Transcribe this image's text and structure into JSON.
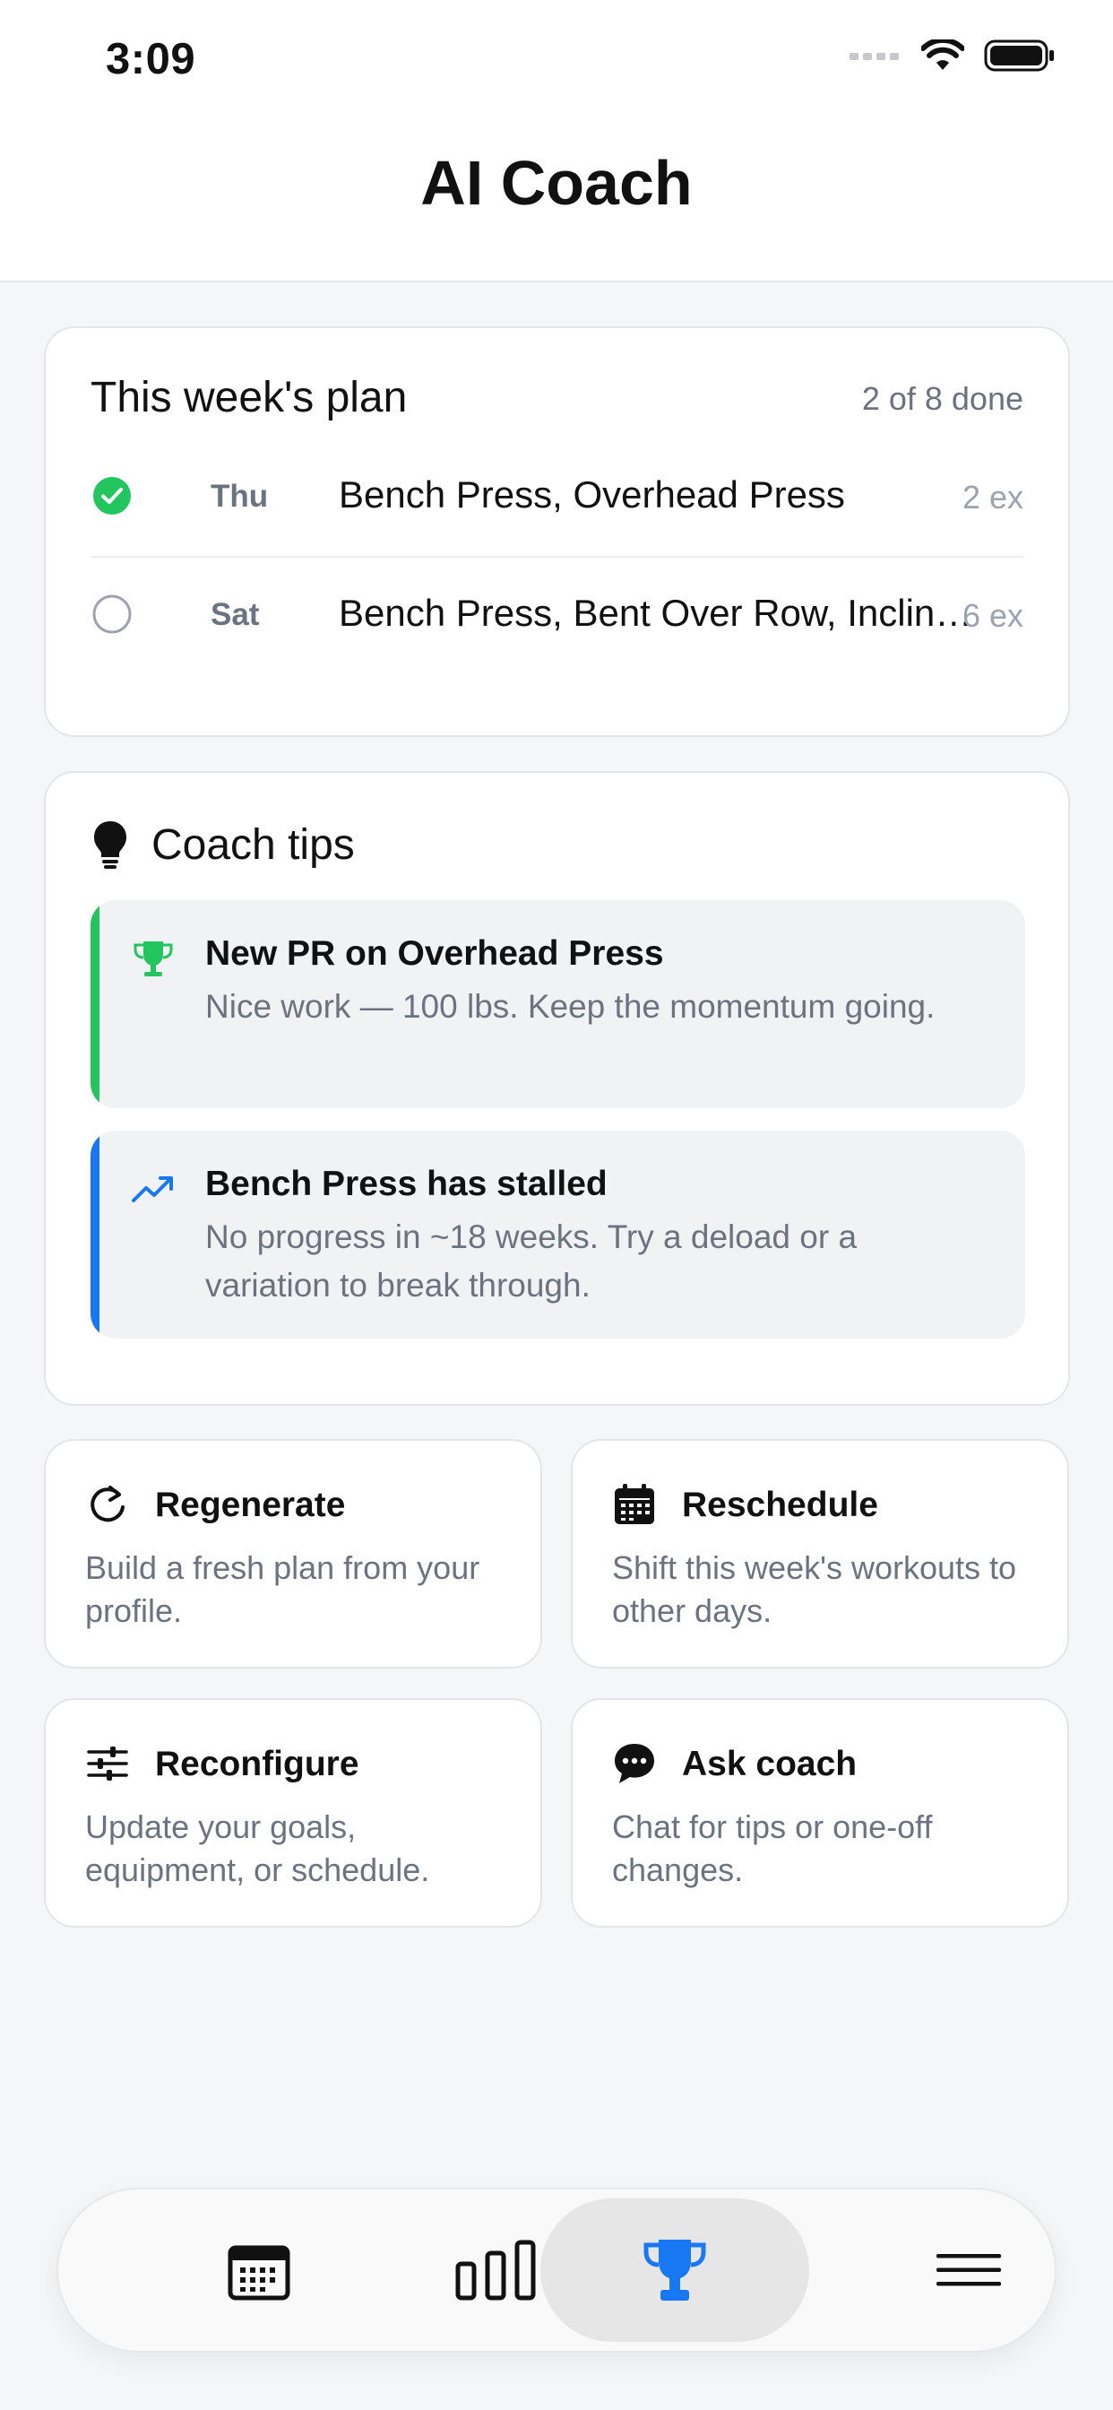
{
  "status_bar": {
    "time": "3:09"
  },
  "header": {
    "title": "AI Coach"
  },
  "plan": {
    "title": "This week's plan",
    "progress": "2 of 8 done",
    "rows": [
      {
        "day": "Thu",
        "exercises": "Bench Press, Overhead Press",
        "count": "2 ex",
        "done": true
      },
      {
        "day": "Sat",
        "exercises": "Bench Press, Bent Over Row, Incline Dumbbell Press",
        "count": "6 ex",
        "done": false
      }
    ]
  },
  "tips": {
    "title": "Coach tips",
    "items": [
      {
        "title": "New PR on Overhead Press",
        "body": "Nice work — 100 lbs. Keep the momentum going.",
        "accent": "#22c55e",
        "icon": "trophy-icon"
      },
      {
        "title": "Bench Press has stalled",
        "body": "No progress in ~18 weeks. Try a deload or a variation to break through.",
        "accent": "#1877f2",
        "icon": "trending-up-icon"
      }
    ]
  },
  "actions": [
    {
      "title": "Regenerate",
      "body": "Build a fresh plan from your profile.",
      "icon": "refresh-icon"
    },
    {
      "title": "Reschedule",
      "body": "Shift this week's workouts to other days.",
      "icon": "calendar-icon"
    },
    {
      "title": "Reconfigure",
      "body": "Update your goals, equipment, or schedule.",
      "icon": "sliders-icon"
    },
    {
      "title": "Ask coach",
      "body": "Chat for tips or one-off changes.",
      "icon": "chat-bubble-icon"
    }
  ],
  "tab_bar": {
    "tabs": [
      {
        "icon": "calendar-icon",
        "active": false
      },
      {
        "icon": "bar-chart-icon",
        "active": false
      },
      {
        "icon": "trophy-icon",
        "active": true
      },
      {
        "icon": "menu-icon",
        "active": false
      }
    ]
  },
  "colors": {
    "accent": "#1877f2",
    "success": "#22c55e",
    "muted": "#6b7280"
  }
}
